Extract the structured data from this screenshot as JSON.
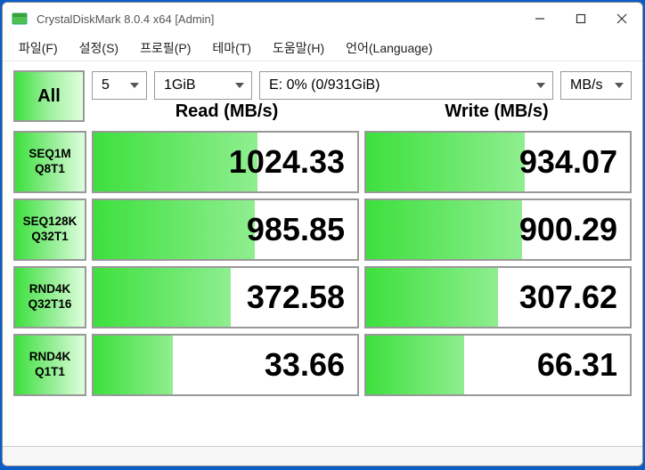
{
  "window": {
    "title": "CrystalDiskMark 8.0.4 x64 [Admin]"
  },
  "menu": {
    "file": "파일(F)",
    "settings": "설정(S)",
    "profile": "프로필(P)",
    "theme": "테마(T)",
    "help": "도움말(H)",
    "language": "언어(Language)"
  },
  "controls": {
    "all": "All",
    "count": "5",
    "size": "1GiB",
    "drive": "E: 0% (0/931GiB)",
    "unit": "MB/s"
  },
  "headers": {
    "read": "Read (MB/s)",
    "write": "Write (MB/s)"
  },
  "tests": [
    {
      "line1": "SEQ1M",
      "line2": "Q8T1",
      "read": "1024.33",
      "write": "934.07",
      "readPct": 62,
      "writePct": 60
    },
    {
      "line1": "SEQ128K",
      "line2": "Q32T1",
      "read": "985.85",
      "write": "900.29",
      "readPct": 61,
      "writePct": 59
    },
    {
      "line1": "RND4K",
      "line2": "Q32T16",
      "read": "372.58",
      "write": "307.62",
      "readPct": 52,
      "writePct": 50
    },
    {
      "line1": "RND4K",
      "line2": "Q1T1",
      "read": "33.66",
      "write": "66.31",
      "readPct": 30,
      "writePct": 37
    }
  ]
}
